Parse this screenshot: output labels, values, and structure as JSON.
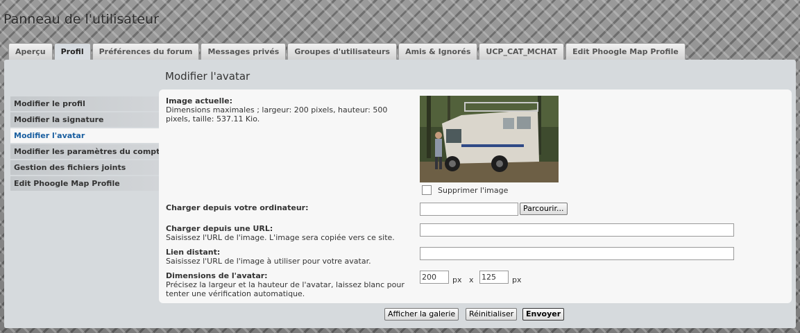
{
  "site": {
    "title": "Panneau de l'utilisateur"
  },
  "tabs": [
    {
      "label": "Aperçu"
    },
    {
      "label": "Profil",
      "active": true
    },
    {
      "label": "Préférences du forum"
    },
    {
      "label": "Messages privés"
    },
    {
      "label": "Groupes d'utilisateurs"
    },
    {
      "label": "Amis & Ignorés"
    },
    {
      "label": "UCP_CAT_MCHAT"
    },
    {
      "label": "Edit Phoogle Map Profile"
    }
  ],
  "sidebar": {
    "items": [
      {
        "label": "Modifier le profil"
      },
      {
        "label": "Modifier la signature"
      },
      {
        "label": "Modifier l'avatar",
        "active": true
      },
      {
        "label": "Modifier les paramètres du compte"
      },
      {
        "label": "Gestion des fichiers joints"
      },
      {
        "label": "Edit Phoogle Map Profile"
      }
    ]
  },
  "page": {
    "heading": "Modifier l'avatar"
  },
  "form": {
    "current": {
      "title": "Image actuelle:",
      "desc": "Dimensions maximales ; largeur: 200 pixels, hauteur: 500 pixels, taille: 537.11 Kio."
    },
    "delete_label": "Supprimer l'image",
    "upload": {
      "title": "Charger depuis votre ordinateur:",
      "browse_label": "Parcourir..."
    },
    "url": {
      "title": "Charger depuis une URL:",
      "desc": "Saisissez l'URL de l'image. L'image sera copiée vers ce site.",
      "value": ""
    },
    "remote": {
      "title": "Lien distant:",
      "desc": "Saisissez l'URL de l'image à utiliser pour votre avatar.",
      "value": ""
    },
    "dimensions": {
      "title": "Dimensions de l'avatar:",
      "desc": "Précisez la largeur et la hauteur de l'avatar, laissez blanc pour tenter une vérification automatique.",
      "width": "200",
      "height": "125",
      "unit": "px",
      "separator": "x"
    }
  },
  "buttons": {
    "gallery": "Afficher la galerie",
    "reset": "Réinitialiser",
    "submit": "Envoyer"
  }
}
